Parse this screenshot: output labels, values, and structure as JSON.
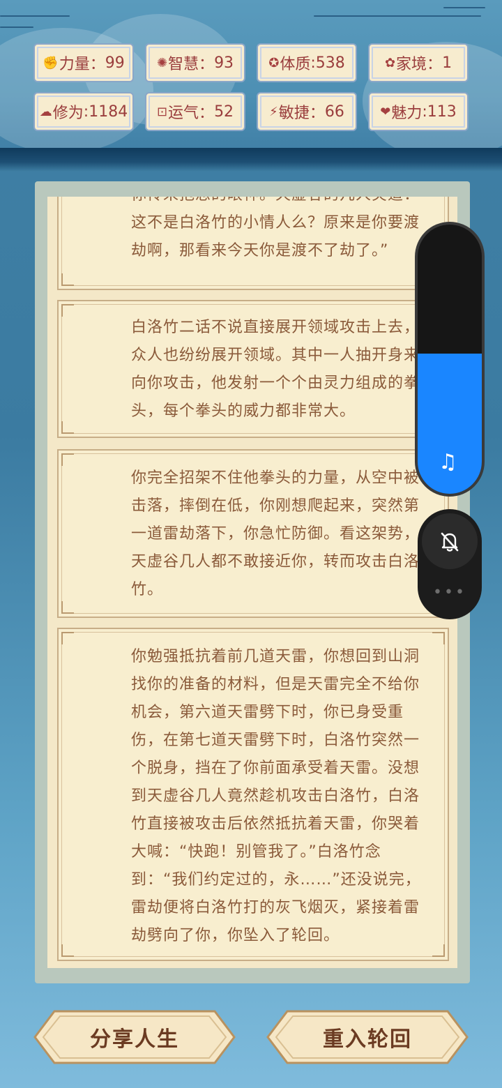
{
  "stats": [
    {
      "icon": "fist-icon",
      "glyph": "✊",
      "label": "力量",
      "sep": "：",
      "value": "99"
    },
    {
      "icon": "bulb-icon",
      "glyph": "✺",
      "label": "智慧",
      "sep": "：",
      "value": "93"
    },
    {
      "icon": "ring-icon",
      "glyph": "✪",
      "label": "体质",
      "sep": ":",
      "value": "538"
    },
    {
      "icon": "hands-icon",
      "glyph": "✿",
      "label": "家境",
      "sep": "：",
      "value": "1"
    },
    {
      "icon": "cloud-icon",
      "glyph": "☁",
      "label": "修为",
      "sep": ":",
      "value": "1184"
    },
    {
      "icon": "luck-icon",
      "glyph": "⊡",
      "label": "运气",
      "sep": "：",
      "value": "52"
    },
    {
      "icon": "lightning-icon",
      "glyph": "⚡",
      "label": "敏捷",
      "sep": "：",
      "value": "66"
    },
    {
      "icon": "heart-icon",
      "glyph": "❤",
      "label": "魅力",
      "sep": ":",
      "value": "113"
    }
  ],
  "story": [
    "你传来抱怨的眼神。天虚谷的几人笑道：这不是白洛竹的小情人么？原来是你要渡劫啊，那看来今天你是渡不了劫了。”",
    "白洛竹二话不说直接展开领域攻击上去，众人也纷纷展开领域。其中一人抽开身来向你攻击，他发射一个个由灵力组成的拳头，每个拳头的威力都非常大。",
    "你完全招架不住他拳头的力量，从空中被击落，摔倒在低，你刚想爬起来，突然第一道雷劫落下，你急忙防御。看这架势，天虚谷几人都不敢接近你，转而攻击白洛竹。",
    "你勉强抵抗着前几道天雷，你想回到山洞找你的准备的材料，但是天雷完全不给你机会，第六道天雷劈下时，你已身受重伤，在第七道天雷劈下时，白洛竹突然一个脱身，挡在了你前面承受着天雷。没想到天虚谷几人竟然趁机攻击白洛竹，白洛竹直接被攻击后依然抵抗着天雷，你哭着大喊：“快跑！别管我了。”白洛竹念到：“我们约定过的，永……”还没说完，雷劫便将白洛竹打的灰飞烟灭，紧接着雷劫劈向了你，你坠入了轮回。"
  ],
  "buttons": {
    "share": "分享人生",
    "restart": "重入轮回"
  },
  "volume": {
    "level": 0.52,
    "icon": "music-note-icon",
    "glyph": "♫"
  },
  "mute": {
    "icon": "bell-slash-icon",
    "more_glyph": "•••"
  },
  "colors": {
    "accent_blue": "#1a86ff",
    "stat_text": "#9a3d3d",
    "story_text": "#8a5a3a"
  }
}
